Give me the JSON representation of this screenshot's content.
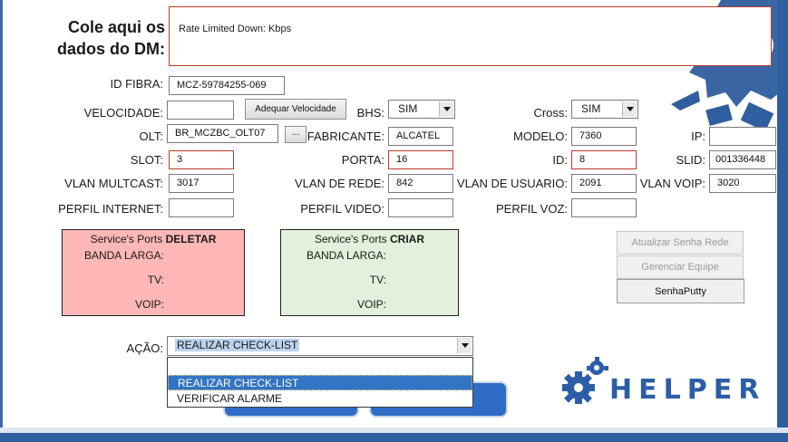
{
  "header": {
    "paste_label_line1": "Cole aqui os",
    "paste_label_line2": "dados do DM:",
    "paste_text": "Rate Limited Down: Kbps"
  },
  "fields": {
    "id_fibra_label": "ID FIBRA:",
    "id_fibra_value": "MCZ-59784255-069",
    "velocidade_label": "VELOCIDADE:",
    "velocidade_value": "",
    "adequar_button": "Adequar Velocidade",
    "bhs_label": "BHS:",
    "bhs_value": "SIM",
    "cross_label": "Cross:",
    "cross_value": "SIM",
    "olt_label": "OLT:",
    "olt_value": "BR_MCZBC_OLT07",
    "olt_browse": "...",
    "fabricante_label": "FABRICANTE:",
    "fabricante_value": "ALCATEL",
    "modelo_label": "MODELO:",
    "modelo_value": "7360",
    "ip_label": "IP:",
    "ip_value": "",
    "slot_label": "SLOT:",
    "slot_value": "3",
    "porta_label": "PORTA:",
    "porta_value": "16",
    "id_label": "ID:",
    "id_value": "8",
    "slid_label": "SLID:",
    "slid_value": "001336448",
    "vlan_multcast_label": "VLAN MULTCAST:",
    "vlan_multcast_value": "3017",
    "vlan_rede_label": "VLAN DE REDE:",
    "vlan_rede_value": "842",
    "vlan_usuario_label": "VLAN DE USUARIO:",
    "vlan_usuario_value": "2091",
    "vlan_voip_label": "VLAN VOIP:",
    "vlan_voip_value": "3020",
    "perfil_internet_label": "PERFIL INTERNET:",
    "perfil_internet_value": "",
    "perfil_video_label": "PERFIL VIDEO:",
    "perfil_video_value": "",
    "perfil_voz_label": "PERFIL VOZ:",
    "perfil_voz_value": ""
  },
  "panels": {
    "delete": {
      "title_prefix": "Service's Ports ",
      "title_strong": "DELETAR",
      "banda": "BANDA LARGA:",
      "tv": "TV:",
      "voip": "VOIP:",
      "color": "#ffb7b7"
    },
    "create": {
      "title_prefix": "Service's Ports ",
      "title_strong": "CRIAR",
      "banda": "BANDA LARGA:",
      "tv": "TV:",
      "voip": "VOIP:",
      "color": "#e3f0dc"
    }
  },
  "side_buttons": {
    "atualizar": "Atualizar Senha Rede",
    "gerenciar": "Gerenciar Equipe",
    "senhaputty": "SenhaPutty"
  },
  "acao": {
    "label": "AÇÃO:",
    "selected": "REALIZAR CHECK-LIST",
    "options": [
      "REALIZAR CHECK-LIST",
      "VERIFICAR ALARME"
    ]
  },
  "logo": {
    "text": "HELPER",
    "color": "#2b5ea6"
  },
  "colors": {
    "accent_blue": "#2f5f9e",
    "error_red": "#c0392b",
    "selection_blue": "#3374c4"
  }
}
